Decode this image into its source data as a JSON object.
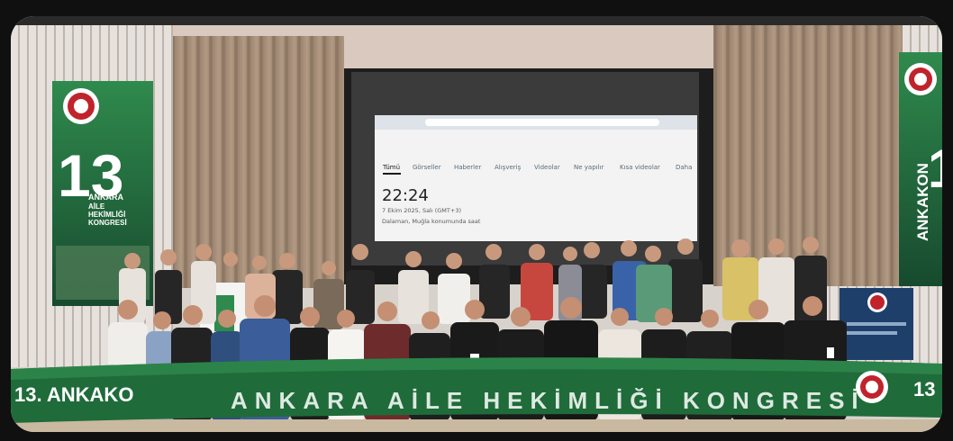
{
  "left_banner": {
    "number": "13",
    "line1": "ANKARA",
    "line2": "AİLE",
    "line3": "HEKİMLİĞİ",
    "line4": "KONGRESİ"
  },
  "right_banner": {
    "vertical_text": "ANKAKON",
    "number": "1"
  },
  "front_banner": {
    "left_text": "13. ANKAKO",
    "center_text": "ANKARA AİLE HEKİMLİĞİ KONGRESİ",
    "right_number": "13"
  },
  "screen": {
    "tabs": [
      "Tümü",
      "Görseller",
      "Haberler",
      "Alışveriş",
      "Videolar",
      "Ne yapılır",
      "Kısa videolar",
      "Daha"
    ],
    "time": "22:24",
    "date": "7 Ekim 2025, Salı (GMT+3)",
    "location": "Dalaman, Muğla konumunda saat"
  },
  "colors": {
    "banner_green": "#1f6b3a",
    "banner_dark": "#174a2e",
    "curtain": "#a88f78",
    "screen_bg": "#f2f3f2",
    "accent_red": "#c0232b"
  }
}
